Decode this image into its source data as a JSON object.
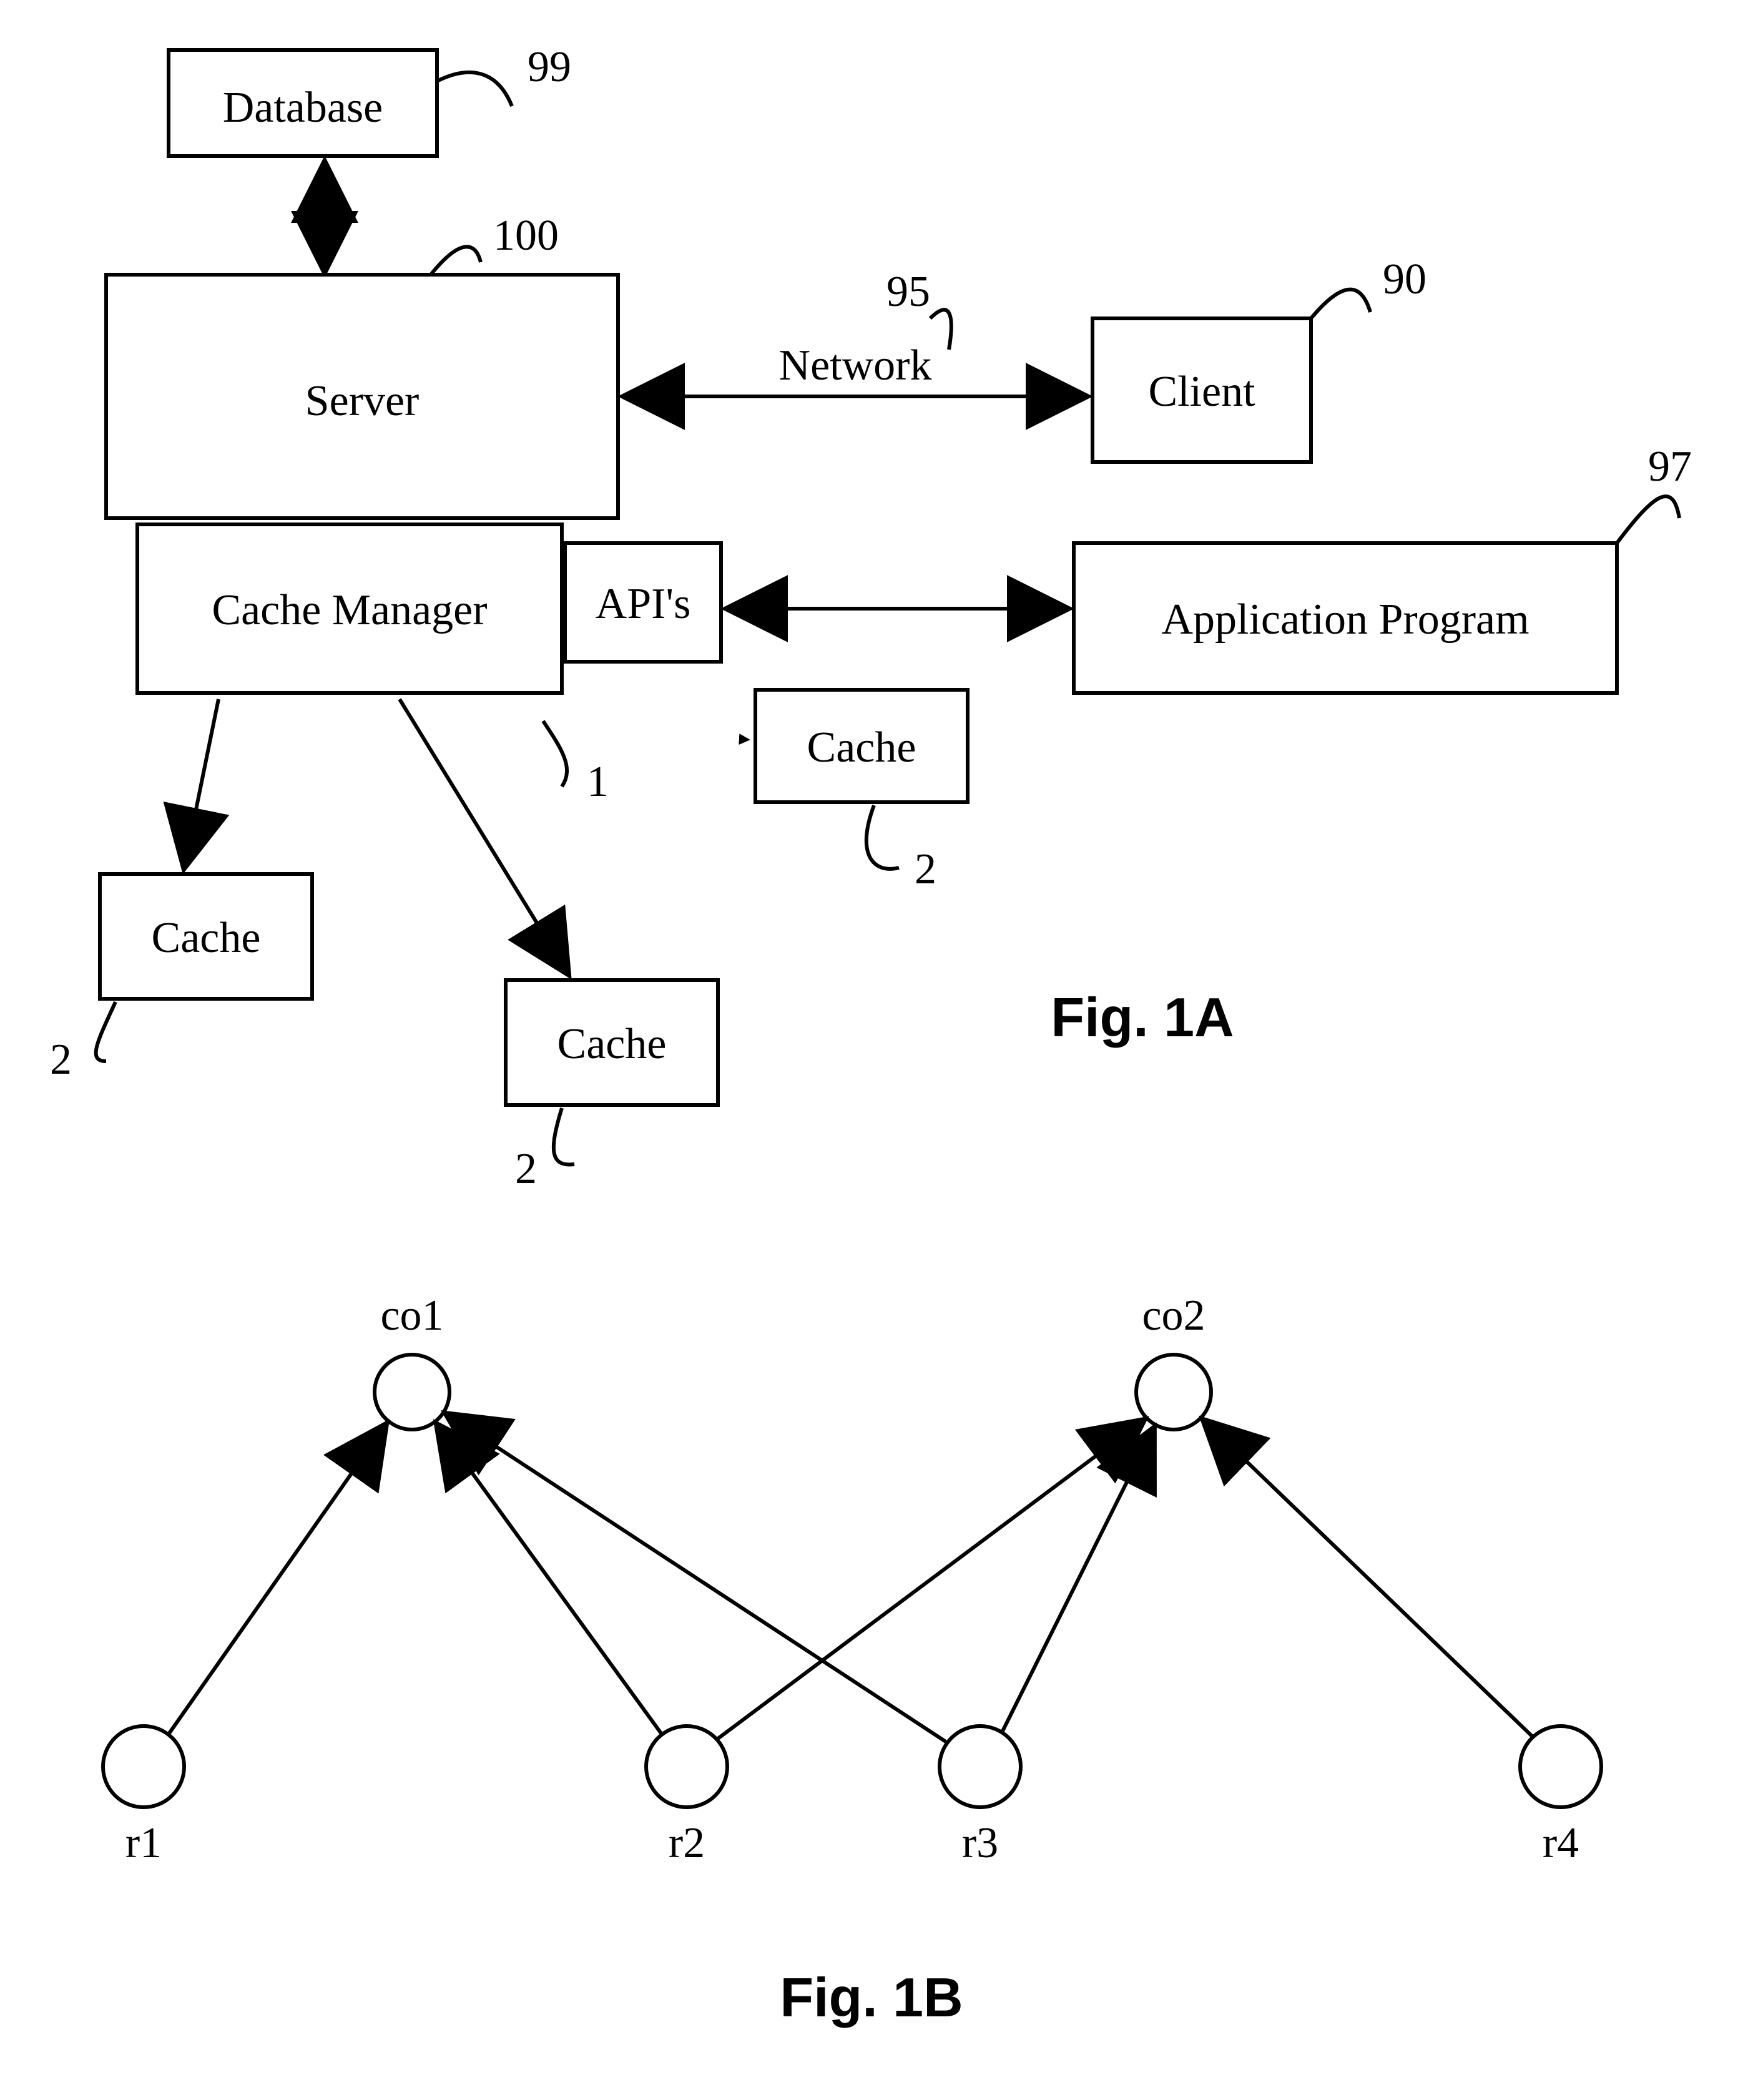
{
  "fig1a": {
    "database": {
      "label": "Database",
      "ref": "99"
    },
    "server": {
      "label": "Server",
      "ref": "100"
    },
    "client": {
      "label": "Client",
      "ref": "90"
    },
    "network": {
      "label": "Network",
      "ref": "95"
    },
    "cacheManager": {
      "label": "Cache Manager",
      "ref": "1"
    },
    "apis": {
      "label": "API's"
    },
    "appProgram": {
      "label": "Application Program",
      "ref": "97"
    },
    "cache1": {
      "label": "Cache",
      "ref": "2"
    },
    "cache2": {
      "label": "Cache",
      "ref": "2"
    },
    "cache3": {
      "label": "Cache",
      "ref": "2"
    },
    "title": "Fig. 1A"
  },
  "fig1b": {
    "co1": "co1",
    "co2": "co2",
    "r1": "r1",
    "r2": "r2",
    "r3": "r3",
    "r4": "r4",
    "title": "Fig. 1B"
  }
}
